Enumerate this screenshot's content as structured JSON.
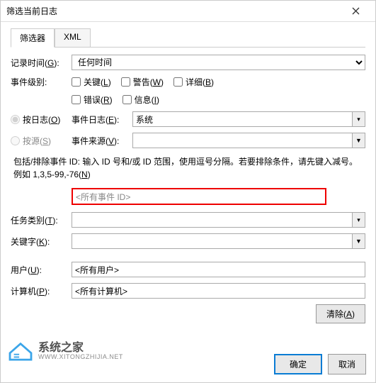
{
  "title": "筛选当前日志",
  "tabs": {
    "filter": "筛选器",
    "xml": "XML"
  },
  "logtime": {
    "label": "记录时间(",
    "letter": "G",
    "suffix": "):",
    "value": "任何时间"
  },
  "level": {
    "label": "事件级别:",
    "critical": "关键(",
    "critical_u": "L",
    "critical_s": ")",
    "warning": "警告(",
    "warning_u": "W",
    "warning_s": ")",
    "verbose": "详细(",
    "verbose_u": "B",
    "verbose_s": ")",
    "error": "错误(",
    "error_u": "R",
    "error_s": ")",
    "info": "信息(",
    "info_u": "I",
    "info_s": ")"
  },
  "radio": {
    "bylog": "按日志(",
    "bylog_u": "O",
    "bylog_s": ")",
    "bysource": "按源(",
    "bysource_u": "S",
    "bysource_s": ")",
    "eventlog": "事件日志(",
    "eventlog_u": "E",
    "eventlog_s": "):",
    "eventlog_value": "系统",
    "source": "事件来源(",
    "source_u": "V",
    "source_s": "):"
  },
  "help": {
    "text": "包括/排除事件 ID: 输入 ID 号和/或 ID 范围，使用逗号分隔。若要排除条件，请先键入减号。例如 1,3,5-99,-76(",
    "u": "N",
    "s": ")"
  },
  "idplaceholder": "<所有事件 ID>",
  "task": {
    "label": "任务类别(",
    "u": "T",
    "s": "):"
  },
  "keyword": {
    "label": "关键字(",
    "u": "K",
    "s": "):"
  },
  "user": {
    "label": "用户(",
    "u": "U",
    "s": "):",
    "value": "<所有用户>"
  },
  "computer": {
    "label": "计算机(",
    "u": "P",
    "s": "):",
    "value": "<所有计算机>"
  },
  "clear": {
    "label": "清除(",
    "u": "A",
    "s": ")"
  },
  "ok": "确定",
  "cancel": "取消",
  "wm": {
    "name": "系统之家",
    "url": "WWW.XITONGZHIJIA.NET"
  }
}
